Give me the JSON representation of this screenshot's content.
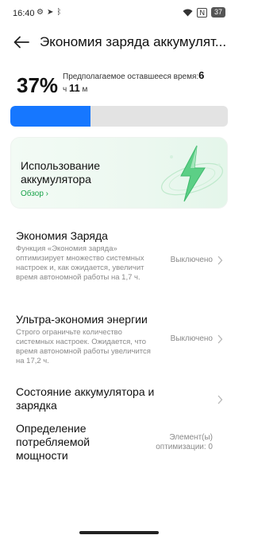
{
  "status_bar": {
    "time": "16:40",
    "left_icons": [
      "gear-icon",
      "navigation-icon",
      "bluetooth-icon"
    ],
    "sim_label": "N",
    "battery_level": "37"
  },
  "header": {
    "title": "Экономия заряда аккумулят..."
  },
  "summary": {
    "percent": "37%",
    "remaining_label": "Предполагаемое оставшееся время:",
    "hours": "6",
    "hours_unit": "ч",
    "minutes": "11",
    "minutes_unit": "м",
    "level_fraction": 0.37
  },
  "usage_card": {
    "title": "Использование аккумулятора",
    "link": "Обзор",
    "accent_color": "#1aa34a"
  },
  "settings": [
    {
      "title": "Экономия Заряда",
      "description": "Функция «Экономия заряда» оптимизирует множество системных настроек и, как ожидается, увеличит время автономной работы на 1,7 ч.",
      "value": "Выключено"
    },
    {
      "title": "Ультра-экономия энергии",
      "description": "Строго ограничьте количество системных настроек. Ожидается, что время автономной работы увеличится на 17,2 ч.",
      "value": "Выключено"
    },
    {
      "title": "Состояние аккумулятора и зарядка",
      "description": "",
      "value": ""
    },
    {
      "title": "Определение потребляемой мощности",
      "description": "",
      "value": "Элемент(ы) оптимизации: 0"
    }
  ],
  "colors": {
    "battery_fill": "#1677ff",
    "battery_track": "#e3e3e3"
  }
}
